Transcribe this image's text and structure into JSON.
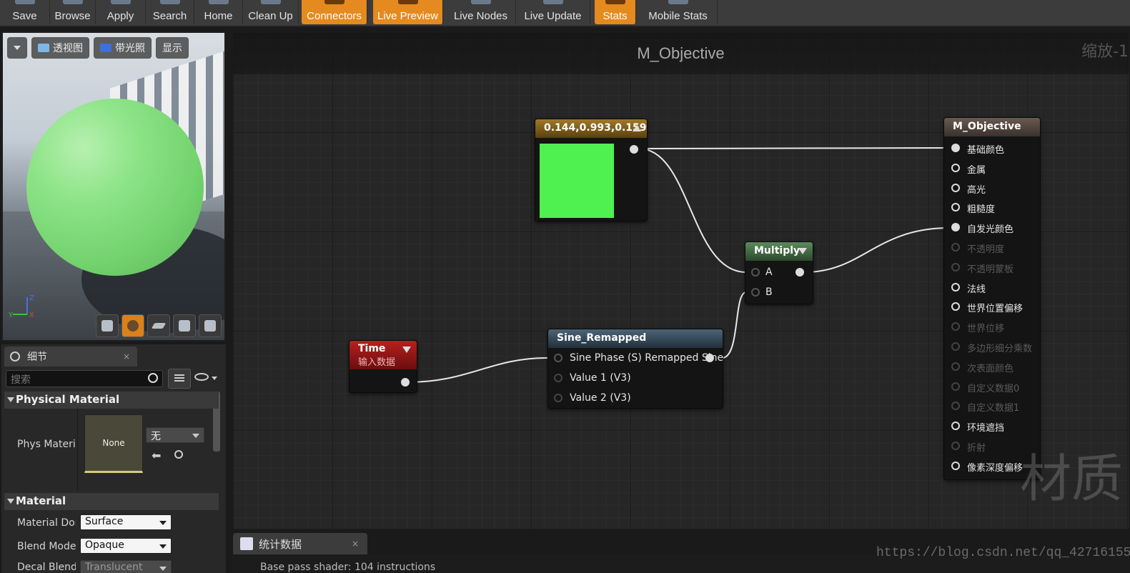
{
  "toolbar": {
    "buttons": [
      {
        "label": "Save",
        "icon": "save-icon",
        "active": false
      },
      {
        "label": "Browse",
        "icon": "browse-icon",
        "active": false
      },
      {
        "label": "Apply",
        "icon": "apply-icon",
        "active": false
      },
      {
        "label": "Search",
        "icon": "search-icon",
        "active": false
      },
      {
        "label": "Home",
        "icon": "home-icon",
        "active": false
      },
      {
        "label": "Clean Up",
        "icon": "cleanup-icon",
        "active": false
      },
      {
        "label": "Connectors",
        "icon": "connectors-icon",
        "active": true
      },
      {
        "label": "Live Preview",
        "icon": "live-preview-icon",
        "active": true
      },
      {
        "label": "Live Nodes",
        "icon": "live-nodes-icon",
        "active": false
      },
      {
        "label": "Live Update",
        "icon": "live-update-icon",
        "active": false
      },
      {
        "label": "Stats",
        "icon": "stats-icon",
        "active": true
      },
      {
        "label": "Mobile Stats",
        "icon": "mobile-stats-icon",
        "active": false
      }
    ],
    "accent": "#e58a1e"
  },
  "viewport": {
    "perspective_label": "透视图",
    "lit_label": "带光照",
    "show_label": "显示",
    "axis": {
      "z": "Z",
      "x": "X",
      "y": "Y"
    },
    "sphere_color": "#7fdd79"
  },
  "details": {
    "tab_label": "细节",
    "tab_close": "×",
    "search_placeholder": "搜索",
    "physical_material_section": "Physical Material",
    "phys_material_label": "Phys Material",
    "phys_material_thumb": "None",
    "phys_material_value": "无",
    "material_section": "Material",
    "material_domain_label": "Material Domain",
    "material_domain_value": "Surface",
    "blend_mode_label": "Blend Mode",
    "blend_mode_value": "Opaque",
    "decal_blend_label": "Decal Blend",
    "decal_blend_value": "Translucent"
  },
  "graph": {
    "title": "M_Objective",
    "zoom": "缩放-1",
    "watermark": "材质",
    "url_watermark": "https://blog.csdn.net/qq_42716155",
    "constant_node": {
      "title": "0.144,0.993,0.159",
      "color": "#4ff150"
    },
    "multiply_node": {
      "title": "Multiply",
      "pin_a": "A",
      "pin_b": "B"
    },
    "time_node": {
      "title": "Time",
      "subtitle": "输入数据"
    },
    "sine_node": {
      "title": "Sine_Remapped",
      "pins": [
        "Sine Phase (S) Remapped Sine",
        "Value 1 (V3)",
        "Value 2 (V3)"
      ]
    },
    "result_node": {
      "title": "M_Objective",
      "pins": [
        {
          "label": "基础颜色",
          "state": "connected"
        },
        {
          "label": "金属",
          "state": "active"
        },
        {
          "label": "高光",
          "state": "active"
        },
        {
          "label": "粗糙度",
          "state": "active"
        },
        {
          "label": "自发光颜色",
          "state": "connected"
        },
        {
          "label": "不透明度",
          "state": "disabled"
        },
        {
          "label": "不透明蒙板",
          "state": "disabled"
        },
        {
          "label": "法线",
          "state": "active"
        },
        {
          "label": "世界位置偏移",
          "state": "active"
        },
        {
          "label": "世界位移",
          "state": "disabled"
        },
        {
          "label": "多边形细分乘数",
          "state": "disabled"
        },
        {
          "label": "次表面颜色",
          "state": "disabled"
        },
        {
          "label": "自定义数据0",
          "state": "disabled"
        },
        {
          "label": "自定义数据1",
          "state": "disabled"
        },
        {
          "label": "环境遮挡",
          "state": "active"
        },
        {
          "label": "折射",
          "state": "disabled"
        },
        {
          "label": "像素深度偏移",
          "state": "active"
        }
      ]
    }
  },
  "stats": {
    "tab_label": "统计数据",
    "tab_close": "×",
    "line": "Base pass shader: 104 instructions"
  }
}
